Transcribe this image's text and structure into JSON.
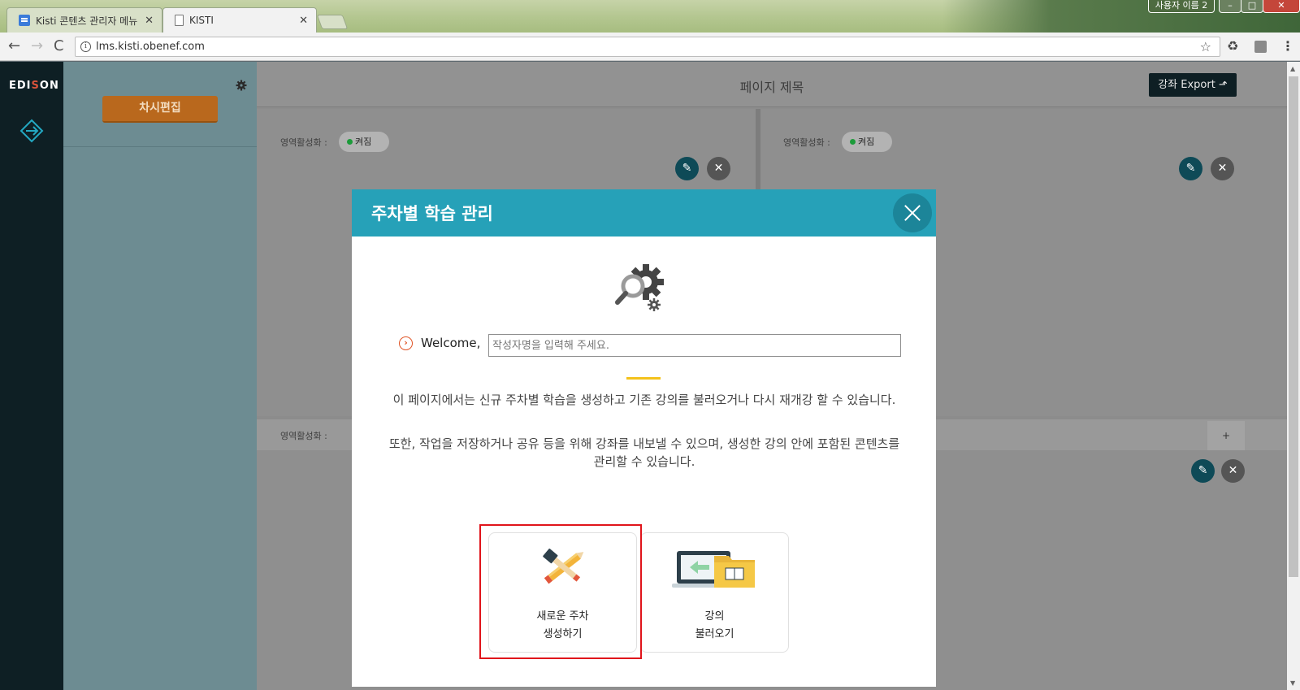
{
  "browser": {
    "tabs": [
      {
        "title": "Kisti 콘텐츠 관리자 메뉴",
        "close": "✕"
      },
      {
        "title": "KISTI",
        "close": "✕"
      }
    ],
    "user_button": "사용자 이름 2",
    "window_buttons": {
      "minimize": "–",
      "maximize": "□",
      "close": "✕"
    },
    "url": "lms.kisti.obenef.com",
    "nav": {
      "back": "←",
      "forward": "→",
      "reload": "C"
    }
  },
  "sidebar": {
    "logo_pre": "EDI",
    "logo_s": "S",
    "logo_post": "ON"
  },
  "panel": {
    "edit_button": "차시편집"
  },
  "main": {
    "page_title": "페이지 제목",
    "export_button": "강좌 Export ⬏",
    "regions": [
      {
        "label": "영역활성화 :",
        "status": "켜짐"
      },
      {
        "label": "영역활성화 :",
        "status": "켜짐"
      },
      {
        "label": "영역활성화 :"
      }
    ],
    "add_tab": "+"
  },
  "modal": {
    "title": "주차별 학습 관리",
    "welcome_label": "Welcome,",
    "name_placeholder": "작성자명을 입력해 주세요.",
    "description_1": "이 페이지에서는 신규 주차별 학습을 생성하고 기존 강의를 불러오거나 다시 재개강 할 수 있습니다.",
    "description_2": "또한, 작업을 저장하거나 공유 등을 위해 강좌를 내보낼 수 있으며, 생성한 강의 안에 포함된 콘텐츠를 관리할 수 있습니다.",
    "cards": [
      {
        "line1": "새로운 주차",
        "line2": "생성하기"
      },
      {
        "line1": "강의",
        "line2": "불러오기"
      }
    ]
  },
  "colors": {
    "modal_header": "#26a1b8",
    "highlight_border": "#e0141b",
    "accent_yellow": "#f4c21b",
    "dark_sidebar": "#0e1f24",
    "status_on": "#1c9b3a"
  },
  "icons": [
    "arrow-exchange-icon",
    "gear-icon",
    "gear-search-icon",
    "chevron-right-circle-icon",
    "pencil-ruler-icon",
    "folder-transfer-icon",
    "edit-icon",
    "close-icon"
  ]
}
